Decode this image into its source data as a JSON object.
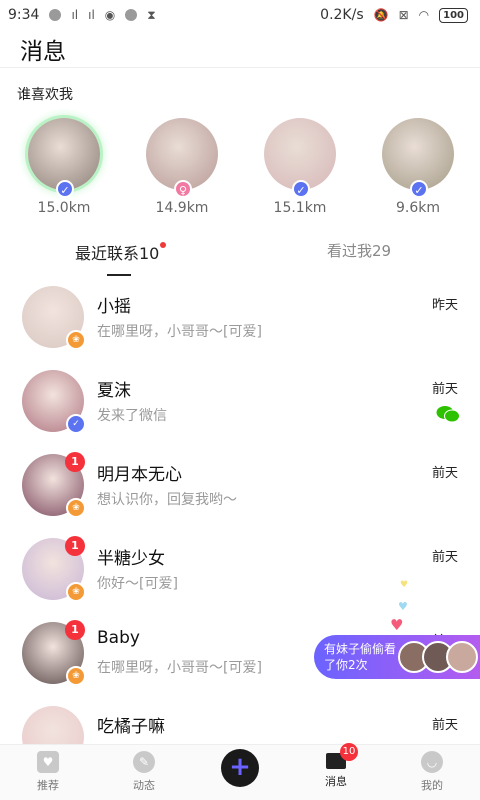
{
  "status_bar": {
    "time": "9:34",
    "network_speed": "0.2K/s",
    "battery": "100",
    "icons": [
      "signal-bars-icon",
      "signal-bars-icon",
      "app-notification-icon",
      "record-icon",
      "hourglass-icon",
      "mute-icon",
      "x-box-icon",
      "wifi-icon",
      "battery-icon"
    ]
  },
  "header": {
    "title": "消息"
  },
  "likes": {
    "title": "谁喜欢我",
    "items": [
      {
        "distance": "15.0km",
        "verify_icon": "verified-check-icon",
        "avatar_color": "#8b7f76"
      },
      {
        "distance": "14.9km",
        "verify_icon": "female-badge-icon",
        "avatar_color": "#b89a96"
      },
      {
        "distance": "15.1km",
        "verify_icon": "verified-check-icon",
        "avatar_color": "#d6b7b7"
      },
      {
        "distance": "9.6km",
        "verify_icon": "verified-check-icon",
        "avatar_color": "#a49b86"
      }
    ]
  },
  "tabs": {
    "recent_label": "最近联系10",
    "viewed_label": "看过我29"
  },
  "conversations": [
    {
      "name": "小摇",
      "message": "在哪里呀，小哥哥～[可爱]",
      "time": "昨天",
      "badge": "",
      "corner": "orange",
      "avatar_color": "#d9c8c2"
    },
    {
      "name": "夏沫",
      "message": "发来了微信",
      "time": "前天",
      "badge": "",
      "corner": "blue",
      "avatar_color": "#b07782",
      "wechat": true
    },
    {
      "name": "明月本无心",
      "message": "想认识你，回复我哟～",
      "time": "前天",
      "badge": "1",
      "corner": "orange",
      "avatar_color": "#7d4a5f"
    },
    {
      "name": "半糖少女",
      "message": "你好～[可爱]",
      "time": "前天",
      "badge": "1",
      "corner": "orange",
      "avatar_color": "#c9b6d6"
    },
    {
      "name": "Baby",
      "message": "在哪里呀，小哥哥～[可爱]",
      "time": "前天",
      "badge": "1",
      "corner": "orange",
      "avatar_color": "#5a4a4a"
    },
    {
      "name": "吃橘子嘛",
      "message": "",
      "time": "前天",
      "badge": "",
      "corner": "",
      "avatar_color": "#e8c9c9"
    }
  ],
  "peek_banner": {
    "text": "有妹子偷偷看了你2次"
  },
  "tabbar": {
    "items": [
      {
        "label": "推荐",
        "icon": "recommend-icon"
      },
      {
        "label": "动态",
        "icon": "compass-icon"
      },
      {
        "label": "",
        "icon": "plus-icon"
      },
      {
        "label": "消息",
        "icon": "message-icon",
        "badge": "10"
      },
      {
        "label": "我的",
        "icon": "profile-icon"
      }
    ]
  },
  "colors": {
    "accent": "#6b63ff",
    "badge_red": "#f5313b",
    "verify_blue": "#5b73f0",
    "vip_orange": "#f39a36"
  }
}
